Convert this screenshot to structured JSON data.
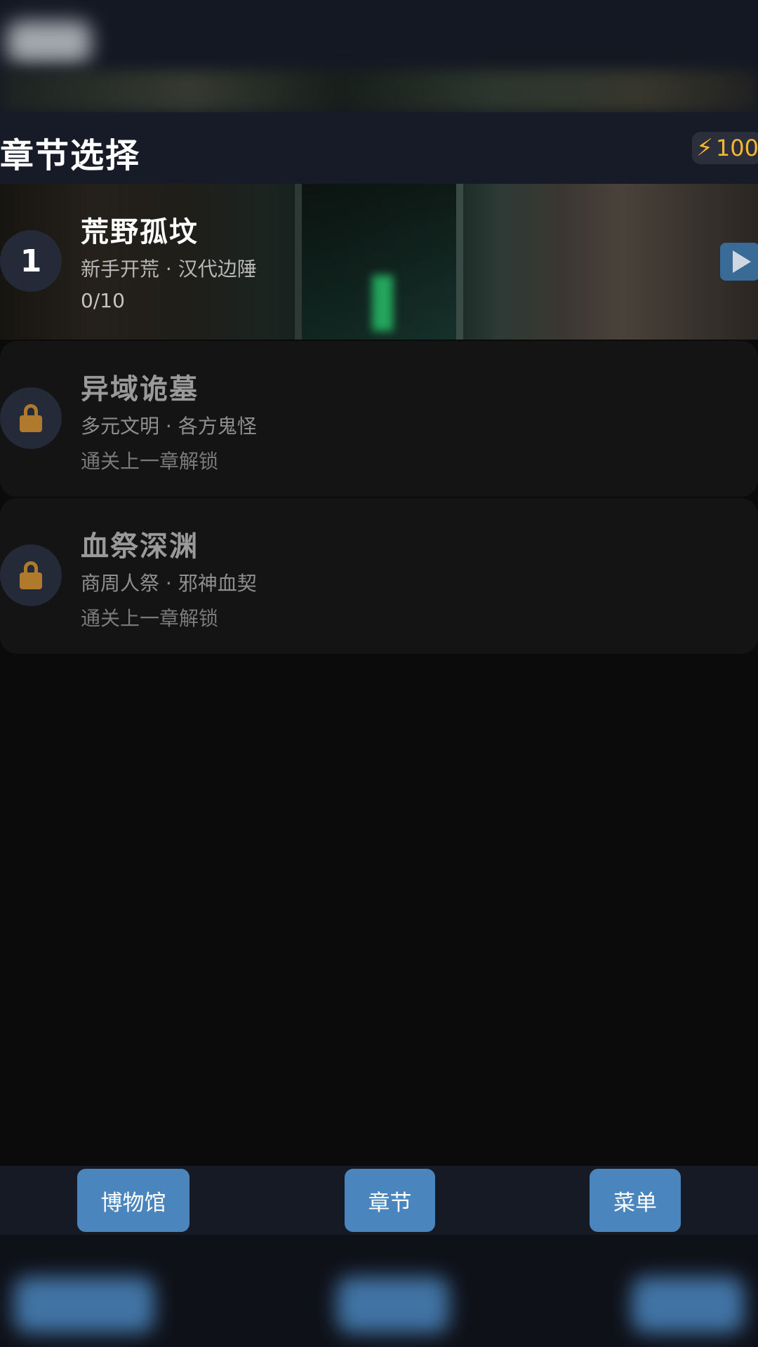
{
  "header": {
    "title": "章节选择",
    "energy_icon": "lightning-bolt-icon",
    "energy_value": "100"
  },
  "chapters": [
    {
      "number": "1",
      "title": "荒野孤坟",
      "subtitle": "新手开荒 · 汉代边陲",
      "progress": "0/10",
      "locked": false
    },
    {
      "title": "异域诡墓",
      "subtitle": "多元文明 · 各方鬼怪",
      "note": "通关上一章解锁",
      "locked": true,
      "icon": "lock-icon"
    },
    {
      "title": "血祭深渊",
      "subtitle": "商周人祭 · 邪神血契",
      "note": "通关上一章解锁",
      "locked": true,
      "icon": "lock-icon"
    }
  ],
  "nav": {
    "museum": "博物馆",
    "chapter": "章节",
    "menu": "菜单"
  },
  "colors": {
    "accent": "#4a85bd",
    "energy": "#f7b731",
    "lock": "#b07a2c",
    "header_bg": "#161b27"
  }
}
